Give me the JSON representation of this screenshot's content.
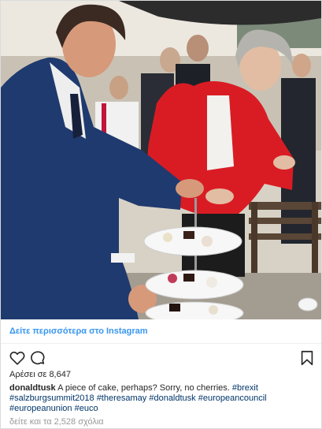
{
  "post": {
    "view_more_label": "Δείτε περισσότερα στο Instagram",
    "likes_text": "Αρέσει σε 8,647",
    "username": "donaldtusk",
    "caption_text": "A piece of cake, perhaps? Sorry, no cherries.",
    "hashtags": [
      "#brexit",
      "#salzburgsummit2018",
      "#theresamay",
      "#donaldtusk",
      "#europeancouncil",
      "#europeanunion",
      "#euco"
    ],
    "comments_text": "δείτε και τα 2,528 σχόλια"
  },
  "icons": {
    "like": "heart-outline-icon",
    "comment": "speech-bubble-icon",
    "save": "bookmark-outline-icon"
  },
  "colors": {
    "link_blue": "#3897f0",
    "hashtag_blue": "#003569",
    "muted_gray": "#999999",
    "border_gray": "#dbdbdb"
  }
}
